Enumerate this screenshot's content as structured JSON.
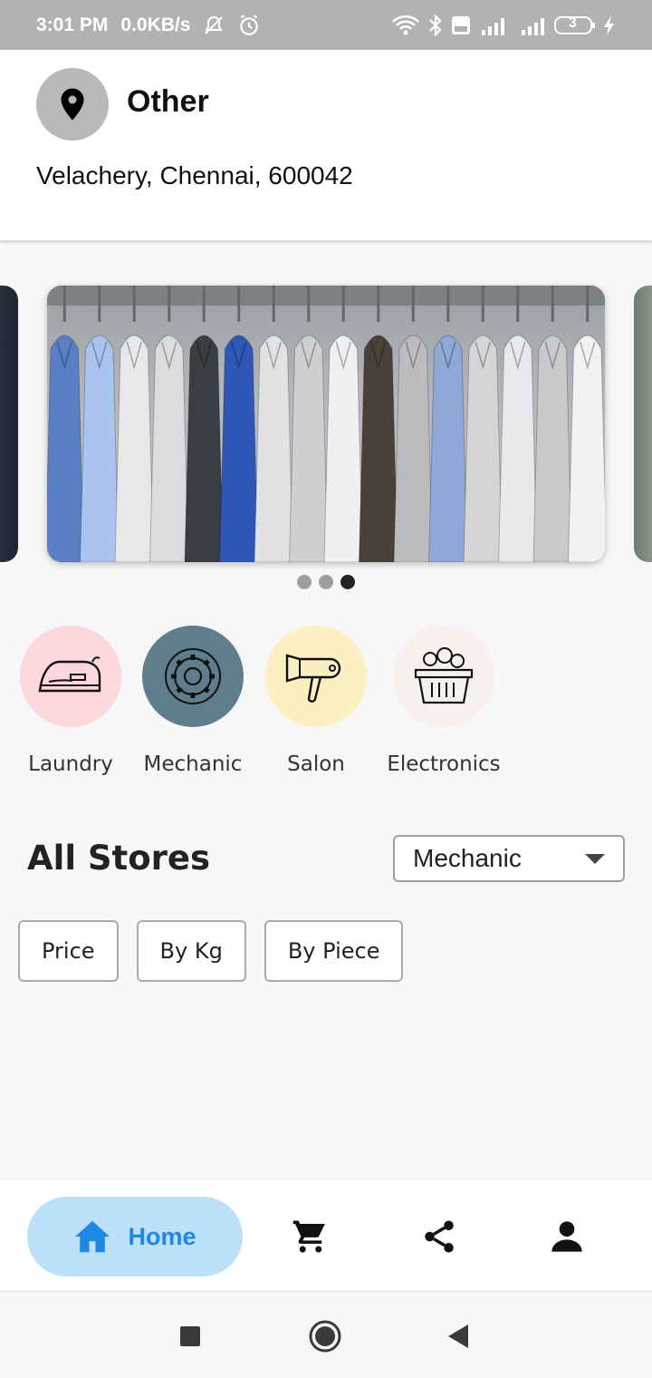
{
  "status_bar": {
    "time": "3:01 PM",
    "net_speed": "0.0KB/s",
    "battery": "3",
    "icons": [
      "muted-bell-icon",
      "alarm-icon",
      "wifi-icon",
      "bluetooth-icon",
      "volte-icon",
      "signal-4g-icon",
      "signal-icon",
      "battery-icon",
      "charging-icon"
    ]
  },
  "location": {
    "type": "Other",
    "address": "Velachery, Chennai, 600042",
    "icon": "location-pin-icon"
  },
  "carousel": {
    "slide_count": 3,
    "active_index": 2,
    "main_image": "shirts-on-hangers"
  },
  "categories": [
    {
      "label": "Laundry",
      "icon": "iron-icon",
      "bg": "#fcd7dc"
    },
    {
      "label": "Mechanic",
      "icon": "gear-icon",
      "bg": "#5f7d8c"
    },
    {
      "label": "Salon",
      "icon": "hair-dryer-icon",
      "bg": "#fcefc2"
    },
    {
      "label": "Electronics",
      "icon": "basket-icon",
      "bg": "#f7f0ee"
    }
  ],
  "stores": {
    "title": "All Stores",
    "filter_selected": "Mechanic",
    "sort_chips": [
      "Price",
      "By Kg",
      "By Piece"
    ]
  },
  "bottom_nav": {
    "home_label": "Home",
    "accent": "#1e88e5",
    "pill_bg": "#bde0fa",
    "items": [
      "home-icon",
      "cart-icon",
      "share-icon",
      "profile-icon"
    ]
  },
  "system_nav": [
    "recents-icon",
    "home-circle-icon",
    "back-icon"
  ]
}
